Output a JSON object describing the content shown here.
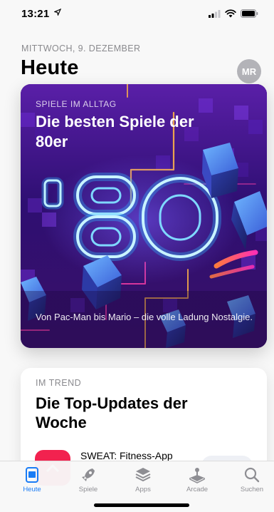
{
  "status_bar": {
    "time": "13:21",
    "location_icon": "location-arrow-icon",
    "signal_icon": "cellular-signal-icon",
    "wifi_icon": "wifi-icon",
    "battery_icon": "battery-icon"
  },
  "header": {
    "date": "MITTWOCH, 9. DEZEMBER",
    "title": "Heute",
    "avatar_initials": "MR"
  },
  "hero_card": {
    "eyebrow": "SPIELE IM ALLTAG",
    "title": "Die besten Spiele der 80er",
    "description": "Von Pac-Man bis Mario – die volle Ladung Nostalgie.",
    "art_text": "'80s"
  },
  "trend_card": {
    "eyebrow": "IM TREND",
    "title": "Die Top-Updates der Woche",
    "app_name": "SWEAT: Fitness-App"
  },
  "tabs": [
    {
      "label": "Heute",
      "icon": "today-icon",
      "active": true
    },
    {
      "label": "Spiele",
      "icon": "rocket-icon",
      "active": false
    },
    {
      "label": "Apps",
      "icon": "layers-icon",
      "active": false
    },
    {
      "label": "Arcade",
      "icon": "joystick-icon",
      "active": false
    },
    {
      "label": "Suchen",
      "icon": "search-icon",
      "active": false
    }
  ],
  "colors": {
    "accent": "#1a7cf5",
    "hero_bg": "#2a0f63",
    "neon_blue": "#46c8ff",
    "neon_pink": "#ff3fa7",
    "app_icon": "#f2224f"
  }
}
